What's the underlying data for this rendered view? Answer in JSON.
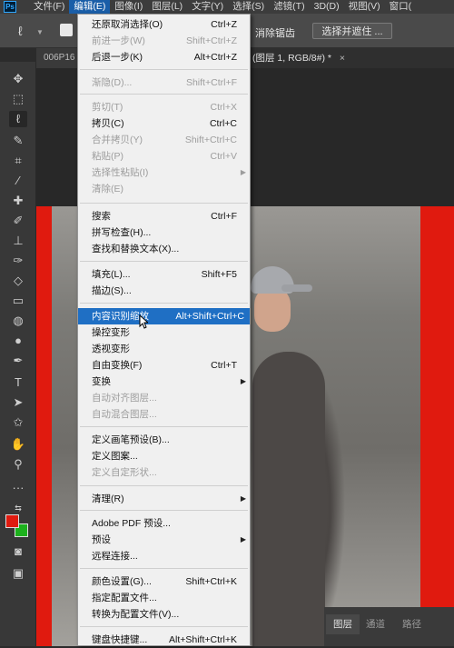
{
  "app": {
    "logo": "Ps"
  },
  "menubar": {
    "items": [
      "文件(F)",
      "编辑(E)",
      "图像(I)",
      "图层(L)",
      "文字(Y)",
      "选择(S)",
      "滤镜(T)",
      "3D(D)",
      "视图(V)",
      "窗口("
    ],
    "active_index": 1
  },
  "options_bar": {
    "label_partial": "消除锯齿",
    "select_button": "选择并遮住 ..."
  },
  "tabs": {
    "tab1": "006P16",
    "tab2": "(图层 1, RGB/8#) *",
    "close": "×"
  },
  "colors": {
    "foreground": "#e01a0f",
    "background": "#1db11d",
    "highlight": "#1f6fc4"
  },
  "edit_menu": {
    "items": [
      {
        "label": "还原取消选择(O)",
        "shortcut": "Ctrl+Z",
        "disabled": false
      },
      {
        "label": "前进一步(W)",
        "shortcut": "Shift+Ctrl+Z",
        "disabled": true
      },
      {
        "label": "后退一步(K)",
        "shortcut": "Alt+Ctrl+Z",
        "disabled": false
      },
      {
        "label": "渐隐(D)...",
        "shortcut": "Shift+Ctrl+F",
        "disabled": true
      },
      {
        "label": "剪切(T)",
        "shortcut": "Ctrl+X",
        "disabled": true
      },
      {
        "label": "拷贝(C)",
        "shortcut": "Ctrl+C",
        "disabled": false
      },
      {
        "label": "合并拷贝(Y)",
        "shortcut": "Shift+Ctrl+C",
        "disabled": true
      },
      {
        "label": "粘贴(P)",
        "shortcut": "Ctrl+V",
        "disabled": true
      },
      {
        "label": "选择性粘贴(I)",
        "shortcut": "",
        "disabled": true,
        "submenu": true
      },
      {
        "label": "清除(E)",
        "shortcut": "",
        "disabled": true
      },
      {
        "label": "搜索",
        "shortcut": "Ctrl+F",
        "disabled": false
      },
      {
        "label": "拼写检查(H)...",
        "shortcut": "",
        "disabled": false
      },
      {
        "label": "查找和替换文本(X)...",
        "shortcut": "",
        "disabled": false
      },
      {
        "label": "填充(L)...",
        "shortcut": "Shift+F5",
        "disabled": false
      },
      {
        "label": "描边(S)...",
        "shortcut": "",
        "disabled": false
      },
      {
        "label": "内容识别缩放",
        "shortcut": "Alt+Shift+Ctrl+C",
        "disabled": false,
        "highlighted": true
      },
      {
        "label": "操控变形",
        "shortcut": "",
        "disabled": false
      },
      {
        "label": "透视变形",
        "shortcut": "",
        "disabled": false
      },
      {
        "label": "自由变换(F)",
        "shortcut": "Ctrl+T",
        "disabled": false
      },
      {
        "label": "变换",
        "shortcut": "",
        "disabled": false,
        "submenu": true
      },
      {
        "label": "自动对齐图层...",
        "shortcut": "",
        "disabled": true
      },
      {
        "label": "自动混合图层...",
        "shortcut": "",
        "disabled": true
      },
      {
        "label": "定义画笔预设(B)...",
        "shortcut": "",
        "disabled": false
      },
      {
        "label": "定义图案...",
        "shortcut": "",
        "disabled": false
      },
      {
        "label": "定义自定形状...",
        "shortcut": "",
        "disabled": true
      },
      {
        "label": "清理(R)",
        "shortcut": "",
        "disabled": false,
        "submenu": true
      },
      {
        "label": "Adobe PDF 预设...",
        "shortcut": "",
        "disabled": false
      },
      {
        "label": "预设",
        "shortcut": "",
        "disabled": false,
        "submenu": true
      },
      {
        "label": "远程连接...",
        "shortcut": "",
        "disabled": false
      },
      {
        "label": "颜色设置(G)...",
        "shortcut": "Shift+Ctrl+K",
        "disabled": false
      },
      {
        "label": "指定配置文件...",
        "shortcut": "",
        "disabled": false
      },
      {
        "label": "转换为配置文件(V)...",
        "shortcut": "",
        "disabled": false
      },
      {
        "label": "键盘快捷键...",
        "shortcut": "Alt+Shift+Ctrl+K",
        "disabled": false
      }
    ]
  },
  "layers_panel": {
    "tabs": [
      "图层",
      "通道",
      "路径"
    ],
    "active_index": 0
  }
}
